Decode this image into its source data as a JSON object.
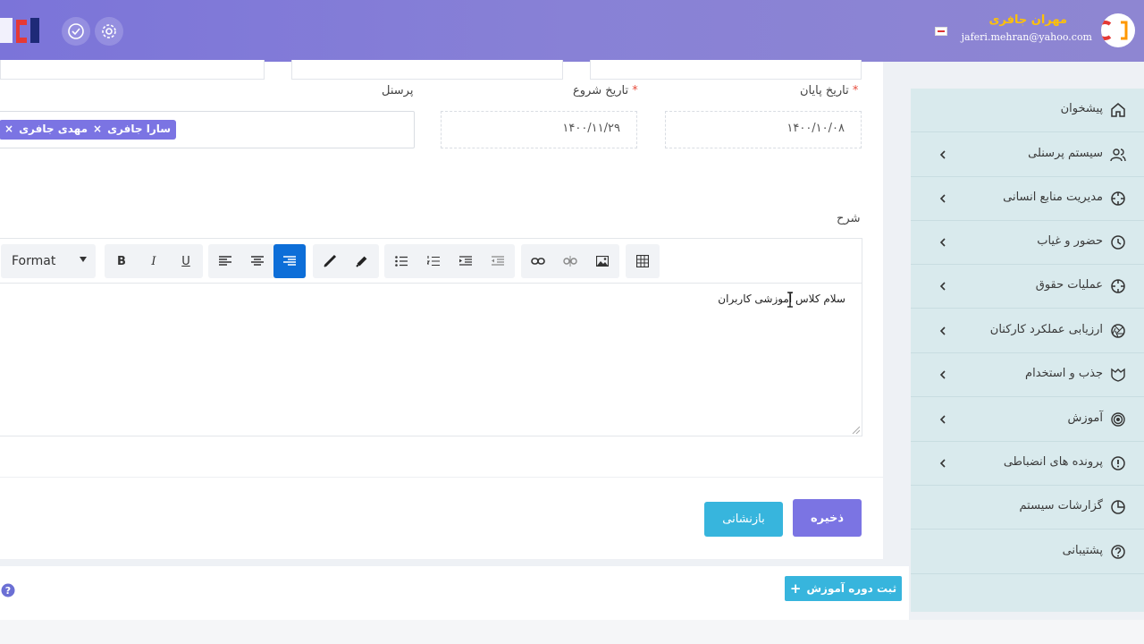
{
  "header": {
    "user_name": "مهران جافری",
    "user_email": "jaferi.mehran@yahoo.com",
    "icons": [
      "logo",
      "check-circle-icon",
      "gear-icon",
      "flag-icon",
      "avatar"
    ]
  },
  "sidebar": {
    "items": [
      {
        "label": "پیشخوان",
        "icon": "home-icon",
        "has_children": false
      },
      {
        "label": "سیستم پرسنلی",
        "icon": "users-icon",
        "has_children": true
      },
      {
        "label": "مدیریت منابع انسانی",
        "icon": "crosshair-icon",
        "has_children": true
      },
      {
        "label": "حضور و غیاب",
        "icon": "clock-icon",
        "has_children": true
      },
      {
        "label": "عملیات حقوق",
        "icon": "crosshair-icon",
        "has_children": true
      },
      {
        "label": "ارزیابی عملکرد کارکنان",
        "icon": "aperture-icon",
        "has_children": true
      },
      {
        "label": "جذب و استخدام",
        "icon": "shield-icon",
        "has_children": true
      },
      {
        "label": "آموزش",
        "icon": "target-icon",
        "has_children": true
      },
      {
        "label": "پرونده های انضباطی",
        "icon": "alert-circle-icon",
        "has_children": true
      },
      {
        "label": "گزارشات سیستم",
        "icon": "pie-chart-icon",
        "has_children": false
      },
      {
        "label": "پشتیبانی",
        "icon": "help-circle-icon",
        "has_children": false
      }
    ]
  },
  "form": {
    "end_date_label": "تاریخ پایان",
    "end_date_value": "۱۴۰۰/۱۰/۰۸",
    "start_date_label": "تاریخ شروع",
    "start_date_value": "۱۴۰۰/۱۱/۲۹",
    "required_mark": "*",
    "personnel_label": "پرسنل",
    "personnel_tags": [
      "سارا جافری",
      "مهدی جافری"
    ],
    "tag_remove": "×",
    "description_label": "شرح"
  },
  "editor": {
    "format_label": "Format",
    "bold": "B",
    "italic": "I",
    "underline": "U",
    "content": "سلام کلاس آموزشی کاربران",
    "active_align": "right"
  },
  "actions": {
    "save_label": "ذخیره",
    "reset_label": "بازنشانی",
    "add_course_label": "ثبت دوره آموزش",
    "add_plus": "+",
    "help_mark": "?"
  },
  "colors": {
    "header": "#7b74d9",
    "primary": "#7b74e3",
    "info": "#37b5dd",
    "active": "#0d6ed8",
    "sidebar": "#d9eaed",
    "user_name": "#ffc107"
  }
}
